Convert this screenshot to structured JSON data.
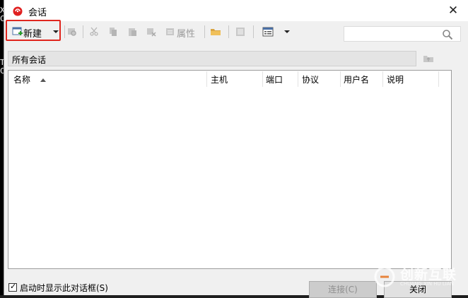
{
  "window": {
    "title": "会话"
  },
  "background": {
    "left_chars": [
      "X",
      "C",
      "T",
      "C"
    ]
  },
  "toolbar": {
    "new_label": "新建",
    "properties_label": "属性",
    "search_placeholder": ""
  },
  "path": {
    "text": "所有会话"
  },
  "table": {
    "columns": [
      "名称",
      "主机",
      "端口",
      "协议",
      "用户名",
      "说明"
    ],
    "rows": []
  },
  "footer": {
    "startup_checkbox_label": "启动时显示此对话框(S)",
    "startup_checked": true,
    "connect_label": "连接(C)",
    "close_label": "关闭"
  },
  "watermark": {
    "text": "创新互联",
    "sub": "CHUANG XIN HU LIAN"
  },
  "colors": {
    "highlight": "#e0261e",
    "icon_gray": "#b5b5b5",
    "accent_red": "#e02020"
  }
}
